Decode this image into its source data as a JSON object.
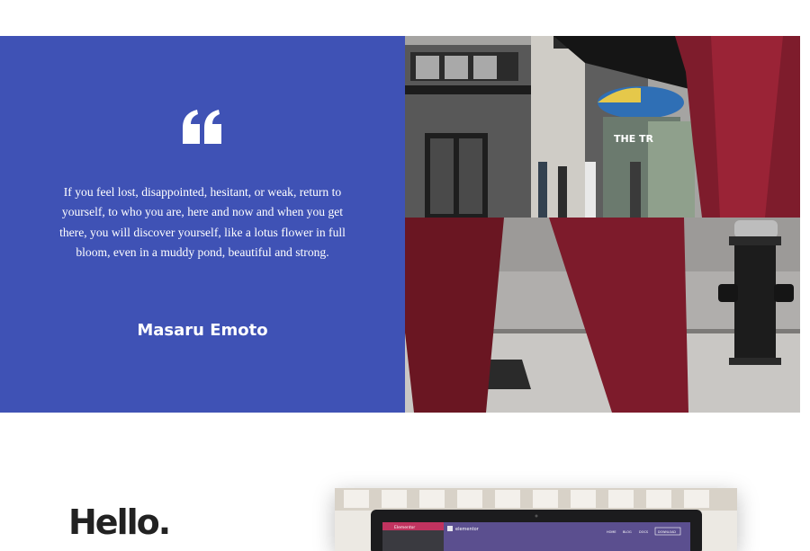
{
  "testimonial": {
    "quote_icon": "quote-left-icon",
    "quote": "If you feel lost, disappointed, hesitant, or weak, return to yourself, to who you are, here and now and when you get there, you will discover yourself, like a lotus flower in full bloom, even in a muddy pond, beautiful and strong.",
    "author": "Masaru Emoto"
  },
  "video": {
    "truck_sign": "THE TR"
  },
  "hello_section": {
    "heading": "Hello.",
    "screenshot": {
      "app_label": "Elementor",
      "brand": "elementor",
      "nav_items": [
        "HOME",
        "BLOG",
        "DOCS"
      ],
      "download_label": "DOWNLOAD"
    }
  },
  "colors": {
    "quote_background": "#3f52b5",
    "text_on_accent": "#ffffff",
    "heading": "#222222"
  }
}
